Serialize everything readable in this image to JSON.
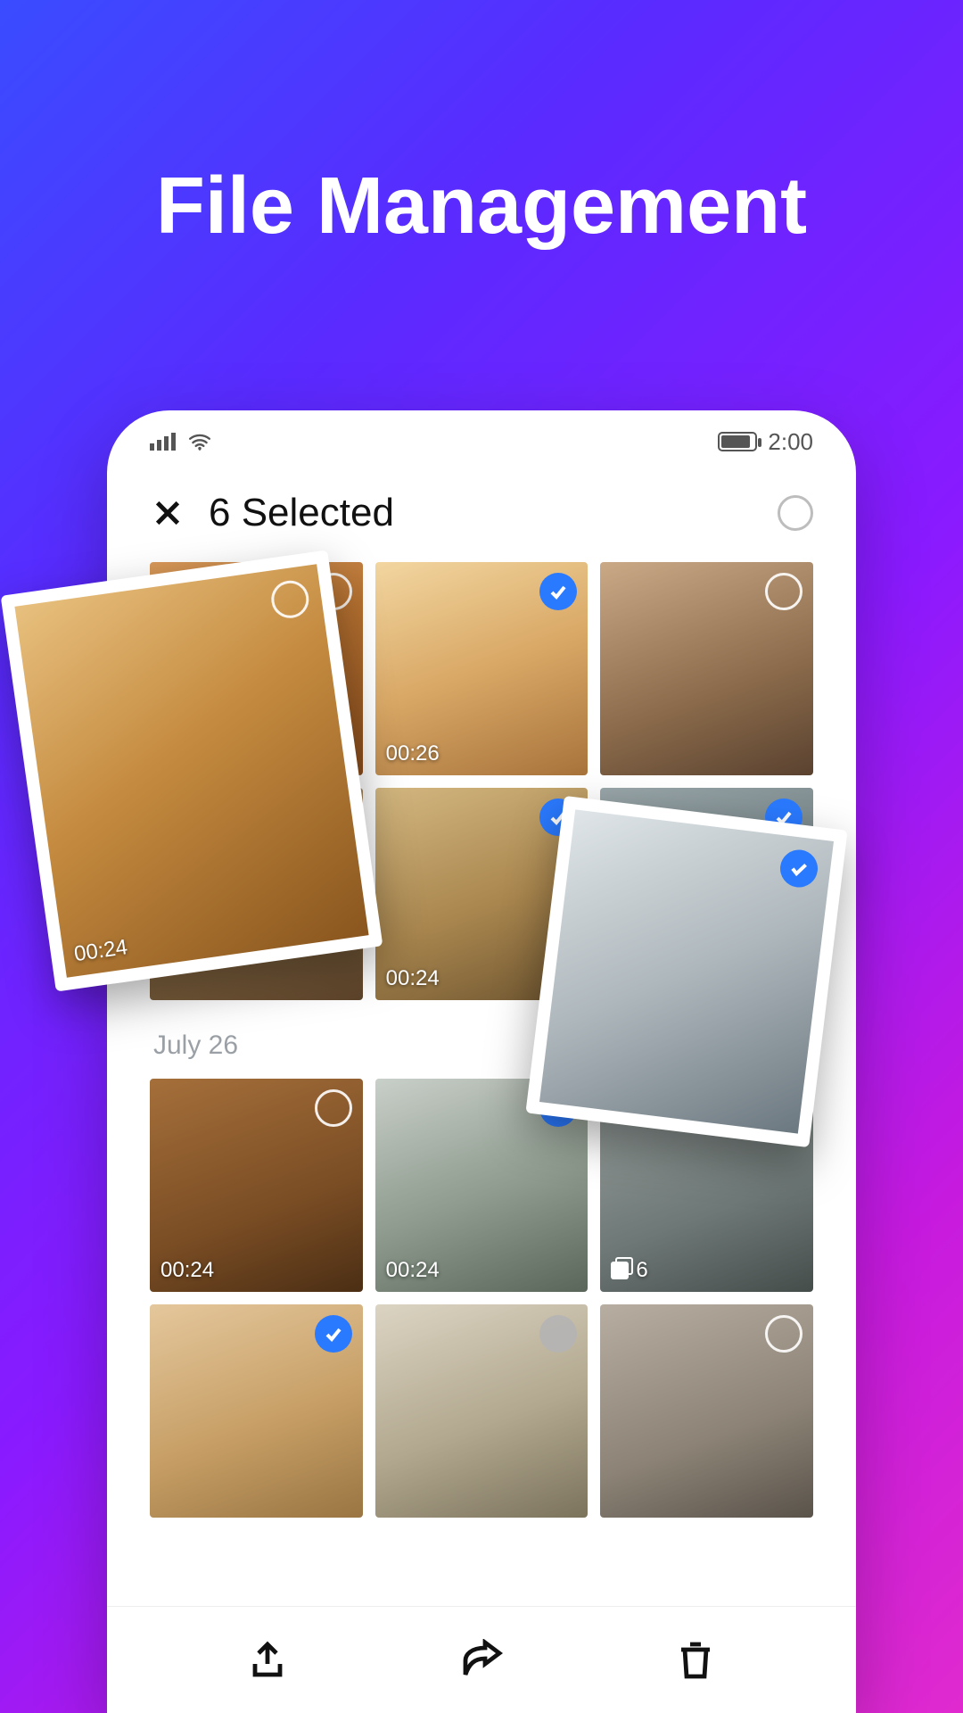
{
  "promo": {
    "headline": "File Management"
  },
  "status": {
    "time": "2:00"
  },
  "appbar": {
    "title": "6 Selected"
  },
  "sections": [
    {
      "date": null,
      "items": [
        {
          "selected": false,
          "duration": "00:24"
        },
        {
          "selected": true,
          "duration": "00:26"
        },
        {
          "selected": false,
          "duration": null
        },
        {
          "selected": true,
          "duration": null
        },
        {
          "selected": true,
          "duration": "00:24"
        },
        {
          "selected": true,
          "duration": null
        }
      ]
    },
    {
      "date": "July 26",
      "items": [
        {
          "selected": false,
          "duration": "00:24"
        },
        {
          "selected": true,
          "duration": "00:24"
        },
        {
          "selected": false,
          "stack": "6"
        },
        {
          "selected": true,
          "duration": null
        },
        {
          "selected_grey": true
        },
        {
          "selected": false
        }
      ]
    }
  ],
  "float": {
    "card1": {
      "duration": "00:24"
    },
    "card2": {
      "selected": true
    }
  }
}
